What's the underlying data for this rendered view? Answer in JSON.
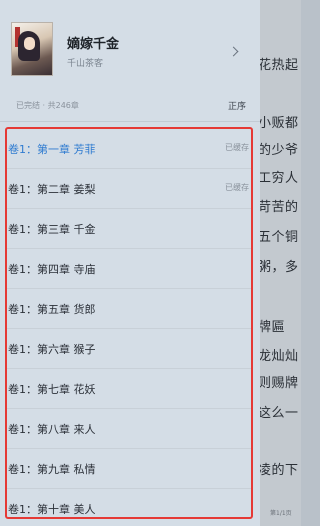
{
  "reader": {
    "lines": [
      "花热起",
      "小贩都",
      "的少爷",
      "工穷人",
      "苛苦的",
      "五个铜",
      "粥，多",
      "牌匾",
      "龙灿灿",
      "则赐牌",
      "这么一",
      "凌的下"
    ],
    "page_indicator": "第1/1页"
  },
  "drawer": {
    "book": {
      "title": "嫡嫁千金",
      "author": "千山茶客",
      "status": "已完结 · 共246章",
      "sort_label": "正序",
      "cover_icon": "book-cover-image"
    },
    "chapters": [
      {
        "title": "卷1：第一章 芳菲",
        "cached": "已缓存",
        "active": true
      },
      {
        "title": "卷1：第二章 姜梨",
        "cached": "已缓存",
        "active": false
      },
      {
        "title": "卷1：第三章 千金",
        "cached": "",
        "active": false
      },
      {
        "title": "卷1：第四章 寺庙",
        "cached": "",
        "active": false
      },
      {
        "title": "卷1：第五章 货郎",
        "cached": "",
        "active": false
      },
      {
        "title": "卷1：第六章 猴子",
        "cached": "",
        "active": false
      },
      {
        "title": "卷1：第七章 花妖",
        "cached": "",
        "active": false
      },
      {
        "title": "卷1：第八章 来人",
        "cached": "",
        "active": false
      },
      {
        "title": "卷1：第九章 私情",
        "cached": "",
        "active": false
      },
      {
        "title": "卷1：第十章 美人",
        "cached": "",
        "active": false
      }
    ]
  },
  "colors": {
    "active_chapter": "#2f7bd0",
    "highlight_border": "#e53935",
    "drawer_bg": "#d4dde6"
  }
}
